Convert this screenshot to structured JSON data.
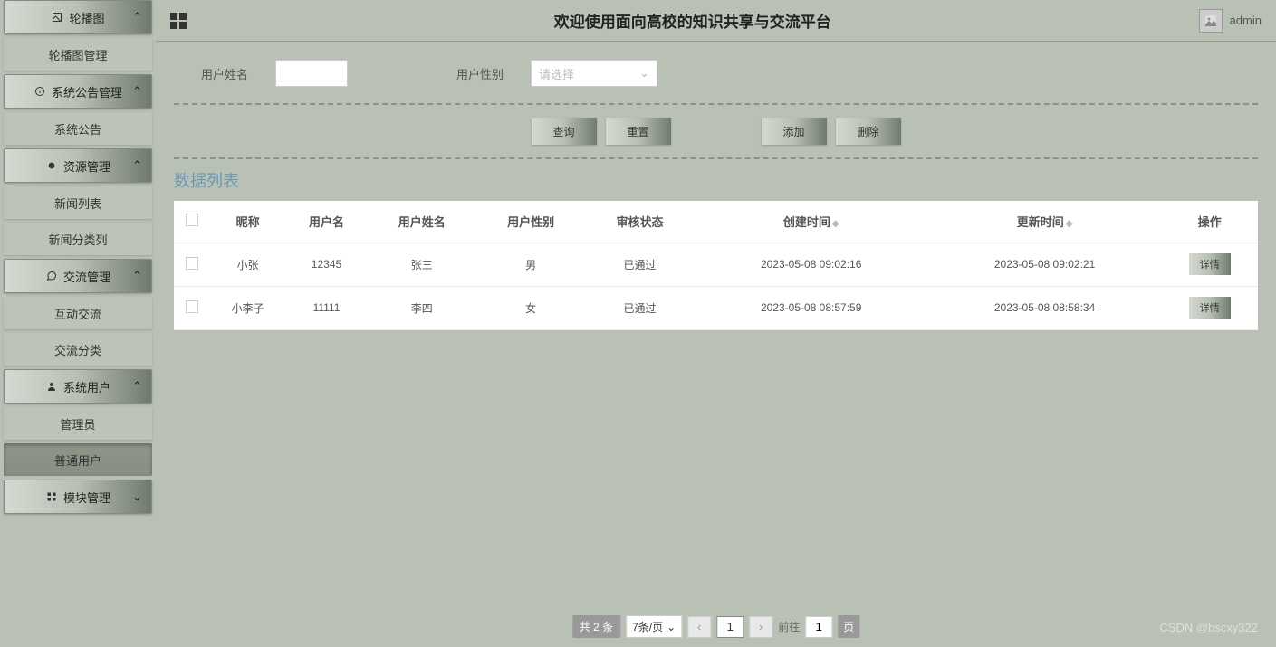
{
  "header": {
    "title": "欢迎使用面向高校的知识共享与交流平台",
    "username": "admin"
  },
  "sidebar": {
    "groups": [
      {
        "icon": "image-icon",
        "label": "轮播图",
        "items": [
          "轮播图管理"
        ]
      },
      {
        "icon": "info-icon",
        "label": "系统公告管理",
        "items": [
          "系统公告"
        ]
      },
      {
        "icon": "dot-icon",
        "label": "资源管理",
        "items": [
          "新闻列表",
          "新闻分类列"
        ]
      },
      {
        "icon": "chat-icon",
        "label": "交流管理",
        "items": [
          "互动交流",
          "交流分类"
        ]
      },
      {
        "icon": "person-icon",
        "label": "系统用户",
        "items": [
          "管理员",
          "普通用户"
        ]
      },
      {
        "icon": "grid-icon",
        "label": "模块管理",
        "items": [],
        "collapsed": true
      }
    ],
    "active_item": "普通用户"
  },
  "filters": {
    "name_label": "用户姓名",
    "name_value": "",
    "gender_label": "用户性别",
    "gender_placeholder": "请选择"
  },
  "actions": {
    "query": "查询",
    "reset": "重置",
    "add": "添加",
    "delete": "删除"
  },
  "list": {
    "title": "数据列表",
    "columns": [
      "昵称",
      "用户名",
      "用户姓名",
      "用户性别",
      "审核状态",
      "创建时间",
      "更新时间",
      "操作"
    ],
    "detail_label": "详情",
    "rows": [
      {
        "nickname": "小张",
        "username": "12345",
        "name": "张三",
        "gender": "男",
        "status": "已通过",
        "created": "2023-05-08 09:02:16",
        "updated": "2023-05-08 09:02:21"
      },
      {
        "nickname": "小李子",
        "username": "11111",
        "name": "李四",
        "gender": "女",
        "status": "已通过",
        "created": "2023-05-08 08:57:59",
        "updated": "2023-05-08 08:58:34"
      }
    ]
  },
  "pager": {
    "total_text": "共 2 条",
    "per_page": "7条/页",
    "current": "1",
    "goto_label": "前往",
    "goto_value": "1",
    "page_suffix": "页"
  },
  "watermark": "CSDN @bscxy322"
}
